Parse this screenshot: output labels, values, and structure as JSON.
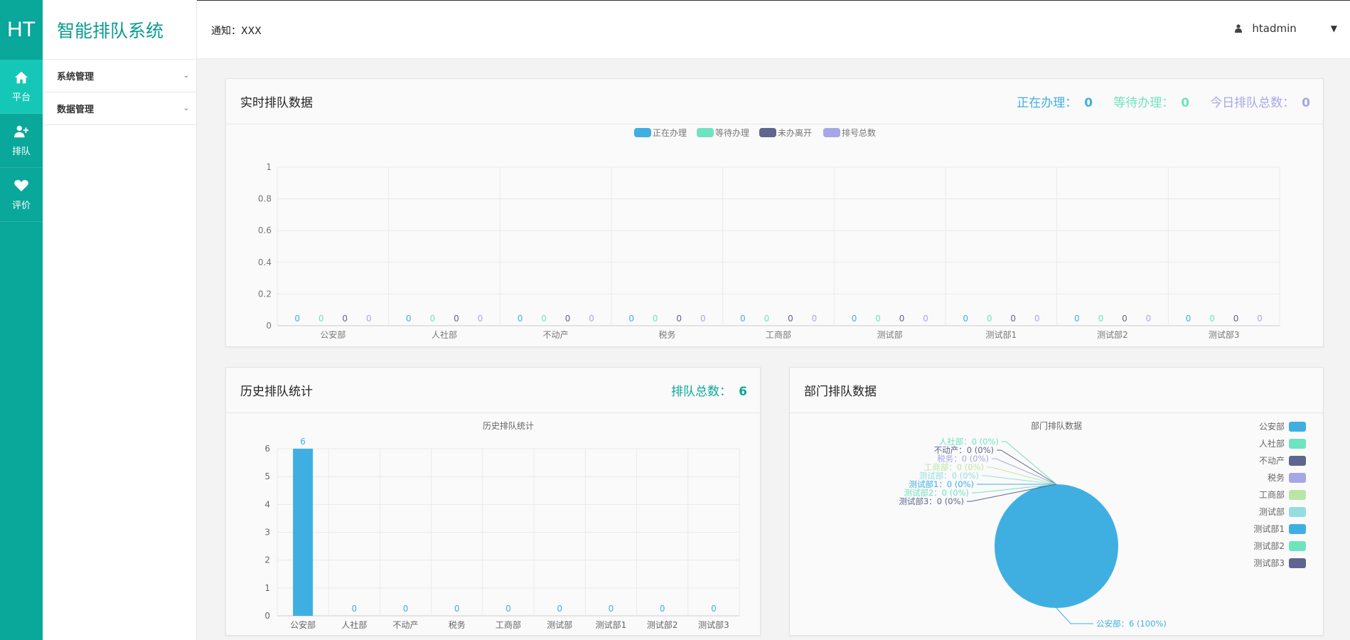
{
  "rail": {
    "logo": "HT",
    "items": [
      {
        "label": "平台",
        "icon": "home-icon",
        "active": true
      },
      {
        "label": "排队",
        "icon": "user-plus-icon",
        "active": false
      },
      {
        "label": "评价",
        "icon": "heart-icon",
        "active": false
      }
    ]
  },
  "sidebar": {
    "title": "智能排队系统",
    "items": [
      {
        "label": "系统管理"
      },
      {
        "label": "数据管理"
      }
    ]
  },
  "topbar": {
    "notice_label": "通知：",
    "notice_value": "XXX",
    "username": "htadmin"
  },
  "colors": {
    "accent": "#0aa79b",
    "series": [
      "#3fafe2",
      "#6fe3c0",
      "#5d668f",
      "#a5a8e6",
      "#b9e6a8",
      "#94dde3"
    ]
  },
  "realtime": {
    "title": "实时排队数据",
    "stats": [
      {
        "label": "正在办理：",
        "value": "0",
        "color": "#3fafe2"
      },
      {
        "label": "等待办理：",
        "value": "0",
        "color": "#6fe3c0"
      },
      {
        "label": "今日排队总数：",
        "value": "0",
        "color": "#a5a8e6"
      }
    ]
  },
  "history": {
    "title": "历史排队统计",
    "stat_label": "排队总数：",
    "stat_value": "6"
  },
  "dept": {
    "title": "部门排队数据"
  },
  "chart_data": [
    {
      "type": "bar",
      "categories": [
        "公安部",
        "人社部",
        "不动产",
        "税务",
        "工商部",
        "测试部",
        "测试部1",
        "测试部2",
        "测试部3"
      ],
      "series": [
        {
          "name": "正在办理",
          "values": [
            0,
            0,
            0,
            0,
            0,
            0,
            0,
            0,
            0
          ]
        },
        {
          "name": "等待办理",
          "values": [
            0,
            0,
            0,
            0,
            0,
            0,
            0,
            0,
            0
          ]
        },
        {
          "name": "未办离开",
          "values": [
            0,
            0,
            0,
            0,
            0,
            0,
            0,
            0,
            0
          ]
        },
        {
          "name": "排号总数",
          "values": [
            0,
            0,
            0,
            0,
            0,
            0,
            0,
            0,
            0
          ]
        }
      ],
      "yticks": [
        "0",
        "0.2",
        "0.4",
        "0.6",
        "0.8",
        "1"
      ],
      "ylim": [
        0,
        1
      ],
      "grid": true,
      "legend": "top-center"
    },
    {
      "type": "bar",
      "title": "历史排队统计",
      "categories": [
        "公安部",
        "人社部",
        "不动产",
        "税务",
        "工商部",
        "测试部",
        "测试部1",
        "测试部2",
        "测试部3"
      ],
      "values": [
        6,
        0,
        0,
        0,
        0,
        0,
        0,
        0,
        0
      ],
      "yticks": [
        "0",
        "1",
        "2",
        "3",
        "4",
        "5",
        "6"
      ],
      "ylim": [
        0,
        6
      ],
      "grid": true
    },
    {
      "type": "pie",
      "title": "部门排队数据",
      "labels": [
        "公安部",
        "人社部",
        "不动产",
        "税务",
        "工商部",
        "测试部",
        "测试部1",
        "测试部2",
        "测试部3"
      ],
      "values": [
        6,
        0,
        0,
        0,
        0,
        0,
        0,
        0,
        0
      ],
      "slice_labels": [
        "公安部：6 (100%)",
        "人社部：0 (0%)",
        "不动产：0 (0%)",
        "税务：0 (0%)",
        "工商部：0 (0%)",
        "测试部：0 (0%)",
        "测试部1：0 (0%)",
        "测试部2：0 (0%)",
        "测试部3：0 (0%)"
      ],
      "legend": "right"
    }
  ]
}
